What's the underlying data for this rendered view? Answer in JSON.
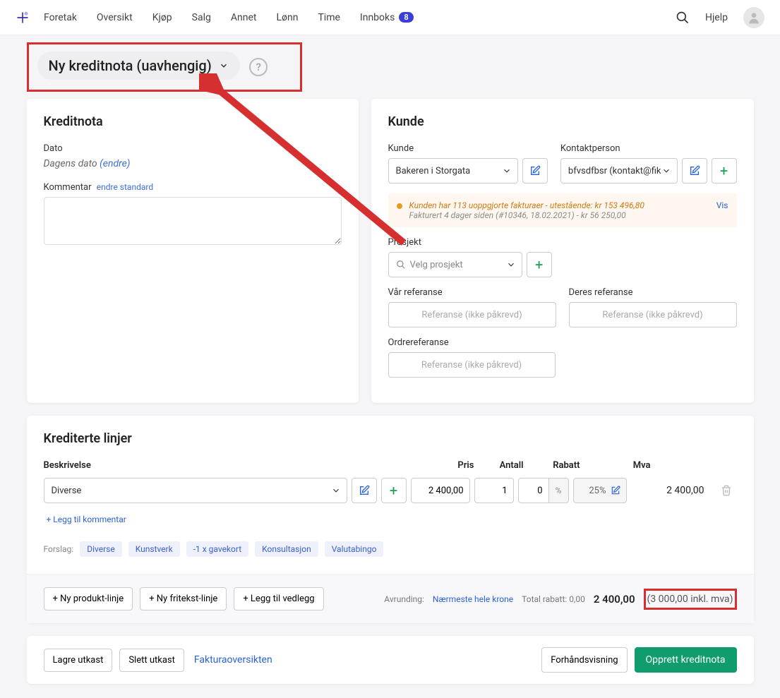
{
  "nav": {
    "items": [
      "Foretak",
      "Oversikt",
      "Kjøp",
      "Salg",
      "Annet",
      "Lønn",
      "Time"
    ],
    "inbox_label": "Innboks",
    "inbox_count": "8",
    "help": "Hjelp"
  },
  "page_title": "Ny kreditnota (uavhengig)",
  "kreditnota": {
    "title": "Kreditnota",
    "date_label": "Dato",
    "date_value": "Dagens dato",
    "date_change": "(endre)",
    "comment_label": "Kommentar",
    "comment_sub": "endre standard"
  },
  "kunde": {
    "title": "Kunde",
    "kunde_label": "Kunde",
    "kunde_value": "Bakeren i Storgata",
    "kontakt_label": "Kontaktperson",
    "kontakt_value": "bfvsdfbsr (kontakt@fik",
    "warn_title": "Kunden har 113 uoppgjorte fakturaer - utestående: kr 153 496,80",
    "warn_sub": "Fakturert 4 dager siden (#10346, 18.02.2021) - kr 56 250,00",
    "warn_vis": "Vis",
    "prosjekt_label": "Prosjekt",
    "prosjekt_placeholder": "Velg prosjekt",
    "var_ref_label": "Vår referanse",
    "deres_ref_label": "Deres referanse",
    "ref_placeholder": "Referanse (ikke påkrevd)",
    "ordre_ref_label": "Ordrereferanse"
  },
  "lines": {
    "title": "Krediterte linjer",
    "cols": {
      "desc": "Beskrivelse",
      "price": "Pris",
      "qty": "Antall",
      "disc": "Rabatt",
      "vat": "Mva"
    },
    "row": {
      "desc": "Diverse",
      "price": "2 400,00",
      "qty": "1",
      "disc": "0",
      "pct": "%",
      "vat": "25%",
      "total": "2 400,00"
    },
    "add_comment": "+ Legg til kommentar",
    "suggestions_label": "Forslag:",
    "suggestions": [
      "Diverse",
      "Kunstverk",
      "-1 x gavekort",
      "Konsultasjon",
      "Valutabingo"
    ],
    "btn_product": "+ Ny produkt-linje",
    "btn_freetext": "+ Ny fritekst-linje",
    "btn_attach": "+ Legg til vedlegg",
    "rounding_label": "Avrunding:",
    "rounding_value": "Nærmeste hele krone",
    "total_disc_label": "Total rabatt: 0,00",
    "total_ex": "2 400,00",
    "total_inc": "(3 000,00 inkl. mva)"
  },
  "bottom": {
    "save_draft": "Lagre utkast",
    "delete_draft": "Slett utkast",
    "overview": "Fakturaoversikten",
    "preview": "Forhåndsvisning",
    "create": "Opprett kreditnota"
  }
}
